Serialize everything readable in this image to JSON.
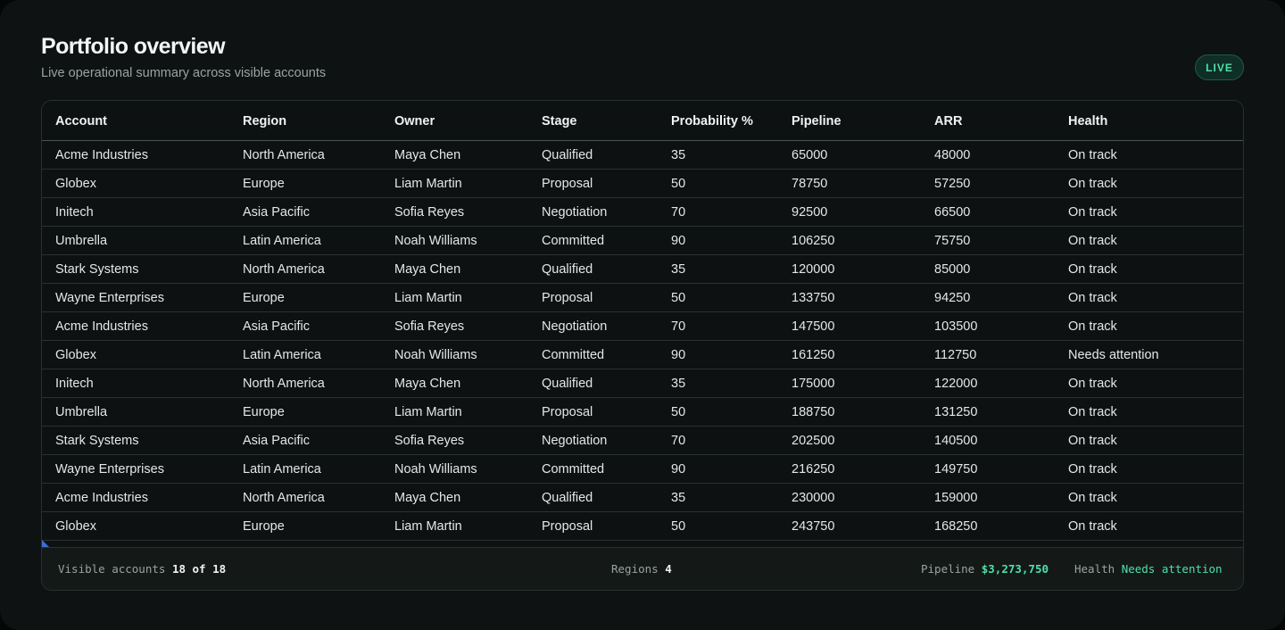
{
  "header": {
    "title": "Portfolio overview",
    "subtitle": "Live operational summary across visible accounts",
    "badge": "LIVE"
  },
  "table": {
    "columns": [
      "Account",
      "Region",
      "Owner",
      "Stage",
      "Probability %",
      "Pipeline",
      "ARR",
      "Health"
    ],
    "rows": [
      [
        "Acme Industries",
        "North America",
        "Maya Chen",
        "Qualified",
        "35",
        "65000",
        "48000",
        "On track"
      ],
      [
        "Globex",
        "Europe",
        "Liam Martin",
        "Proposal",
        "50",
        "78750",
        "57250",
        "On track"
      ],
      [
        "Initech",
        "Asia Pacific",
        "Sofia Reyes",
        "Negotiation",
        "70",
        "92500",
        "66500",
        "On track"
      ],
      [
        "Umbrella",
        "Latin America",
        "Noah Williams",
        "Committed",
        "90",
        "106250",
        "75750",
        "On track"
      ],
      [
        "Stark Systems",
        "North America",
        "Maya Chen",
        "Qualified",
        "35",
        "120000",
        "85000",
        "On track"
      ],
      [
        "Wayne Enterprises",
        "Europe",
        "Liam Martin",
        "Proposal",
        "50",
        "133750",
        "94250",
        "On track"
      ],
      [
        "Acme Industries",
        "Asia Pacific",
        "Sofia Reyes",
        "Negotiation",
        "70",
        "147500",
        "103500",
        "On track"
      ],
      [
        "Globex",
        "Latin America",
        "Noah Williams",
        "Committed",
        "90",
        "161250",
        "112750",
        "Needs attention"
      ],
      [
        "Initech",
        "North America",
        "Maya Chen",
        "Qualified",
        "35",
        "175000",
        "122000",
        "On track"
      ],
      [
        "Umbrella",
        "Europe",
        "Liam Martin",
        "Proposal",
        "50",
        "188750",
        "131250",
        "On track"
      ],
      [
        "Stark Systems",
        "Asia Pacific",
        "Sofia Reyes",
        "Negotiation",
        "70",
        "202500",
        "140500",
        "On track"
      ],
      [
        "Wayne Enterprises",
        "Latin America",
        "Noah Williams",
        "Committed",
        "90",
        "216250",
        "149750",
        "On track"
      ],
      [
        "Acme Industries",
        "North America",
        "Maya Chen",
        "Qualified",
        "35",
        "230000",
        "159000",
        "On track"
      ],
      [
        "Globex",
        "Europe",
        "Liam Martin",
        "Proposal",
        "50",
        "243750",
        "168250",
        "On track"
      ]
    ]
  },
  "footer": {
    "visible_label": "Visible accounts",
    "visible_value": "18 of 18",
    "regions_label": "Regions",
    "regions_value": "4",
    "pipeline_label": "Pipeline",
    "pipeline_value": "$3,273,750",
    "health_label": "Health",
    "health_value": "Needs attention"
  },
  "colors": {
    "accent": "#4fe0a8",
    "background": "#0e1212",
    "grip": "#3b6fd6"
  }
}
